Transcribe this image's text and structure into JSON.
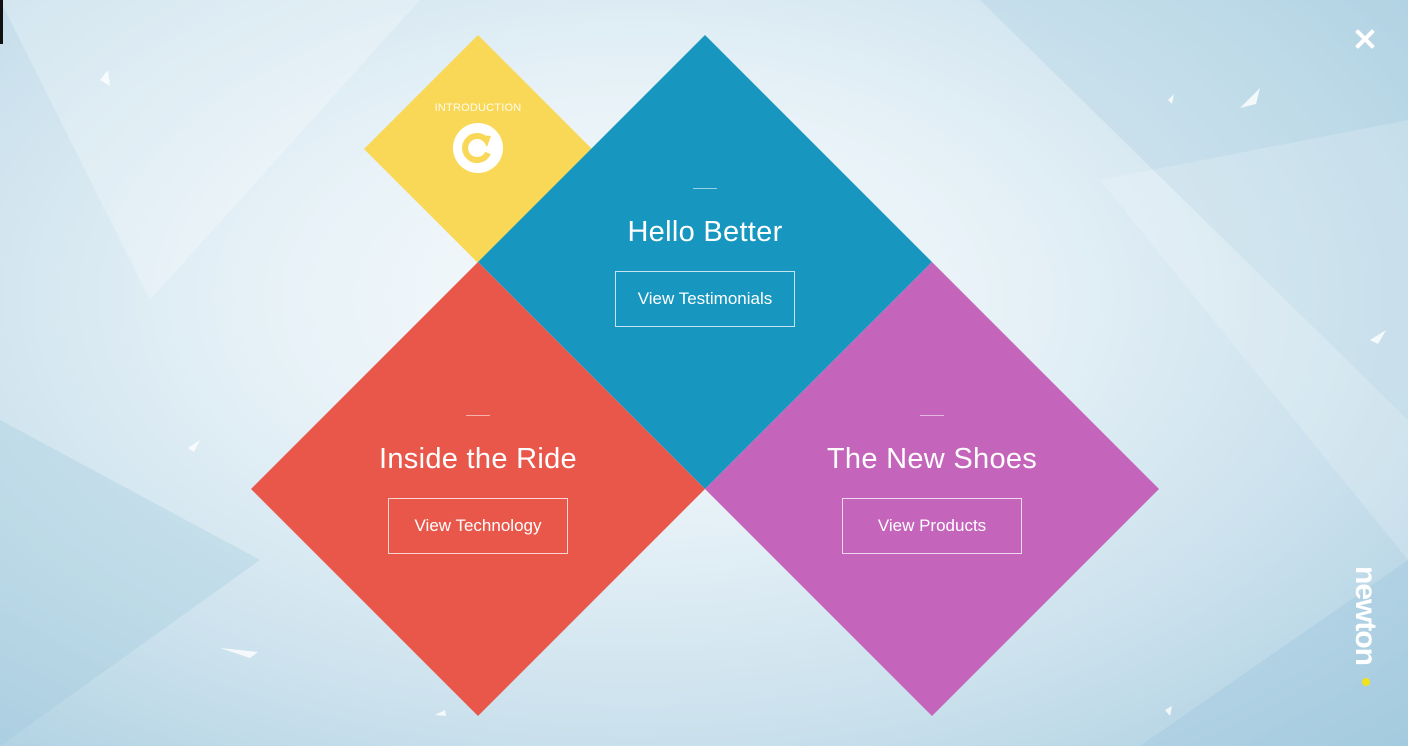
{
  "colors": {
    "intro": "#f9d857",
    "hello": "#1797c0",
    "ride": "#e9574b",
    "shoes": "#c464bb",
    "logo_accent": "#f0e31c"
  },
  "close": {
    "icon": "close-icon"
  },
  "intro": {
    "label": "INTRODUCTION",
    "icon": "replay-icon"
  },
  "hello": {
    "title": "Hello Better",
    "button": "View Testimonials"
  },
  "ride": {
    "title": "Inside the Ride",
    "button": "View Technology"
  },
  "shoes": {
    "title": "The New Shoes",
    "button": "View Products"
  },
  "brand": {
    "logo": "newton"
  }
}
